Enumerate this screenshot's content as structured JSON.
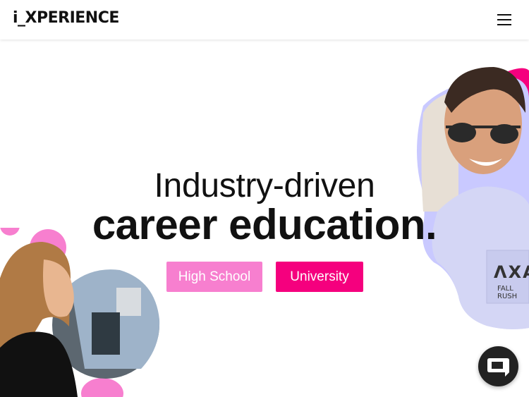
{
  "header": {
    "logo_text": "i_XPERIENCE",
    "menu_icon": "hamburger-menu-icon"
  },
  "hero": {
    "line1": "Industry-driven",
    "line2": "career education.",
    "buttons": {
      "high_school": "High School",
      "university": "University"
    },
    "shirt_text_1": "ΛXA",
    "shirt_text_2": "FALL RUSH"
  },
  "chat": {
    "icon": "chat-icon"
  },
  "colors": {
    "brand_pink": "#f5007e",
    "light_pink": "#f77fcf",
    "blob_lavender": "#c9c9ff"
  }
}
